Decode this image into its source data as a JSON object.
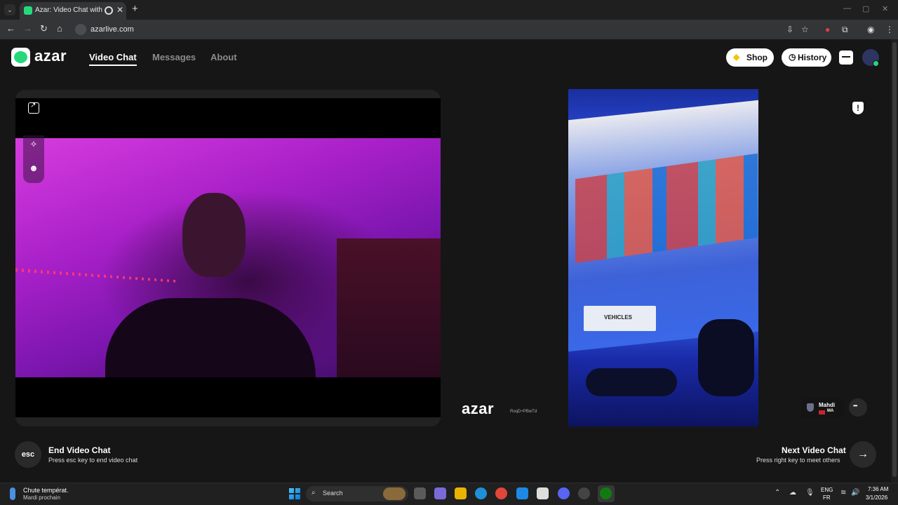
{
  "browser": {
    "tab_title": "Azar: Video Chat with New",
    "url": "azarlive.com"
  },
  "header": {
    "logo_text": "azar",
    "nav": [
      {
        "label": "Video Chat",
        "active": true
      },
      {
        "label": "Messages",
        "active": false
      },
      {
        "label": "About",
        "active": false
      }
    ],
    "shop_label": "Shop",
    "history_label": "History",
    "avatar_badge": "0"
  },
  "remote": {
    "watermark": "azar",
    "watermark_id": "RoqD+PBwTd",
    "peer_name": "Mahdi",
    "peer_country": "MA",
    "game_card_text": "VEHICLES"
  },
  "controls": {
    "esc_label": "esc",
    "end_title": "End Video Chat",
    "end_sub": "Press esc key to end video chat",
    "next_title": "Next Video Chat",
    "next_sub": "Press right key to meet others"
  },
  "taskbar": {
    "weather_line1": "Chute températ.",
    "weather_line2": "Mardi prochain",
    "search_label": "Search",
    "lang_1": "ENG",
    "lang_2": "FR",
    "time": "7:36 AM",
    "date": "3/1/2026"
  },
  "colors": {
    "brand_green": "#25d97a",
    "page_bg": "#161616"
  }
}
